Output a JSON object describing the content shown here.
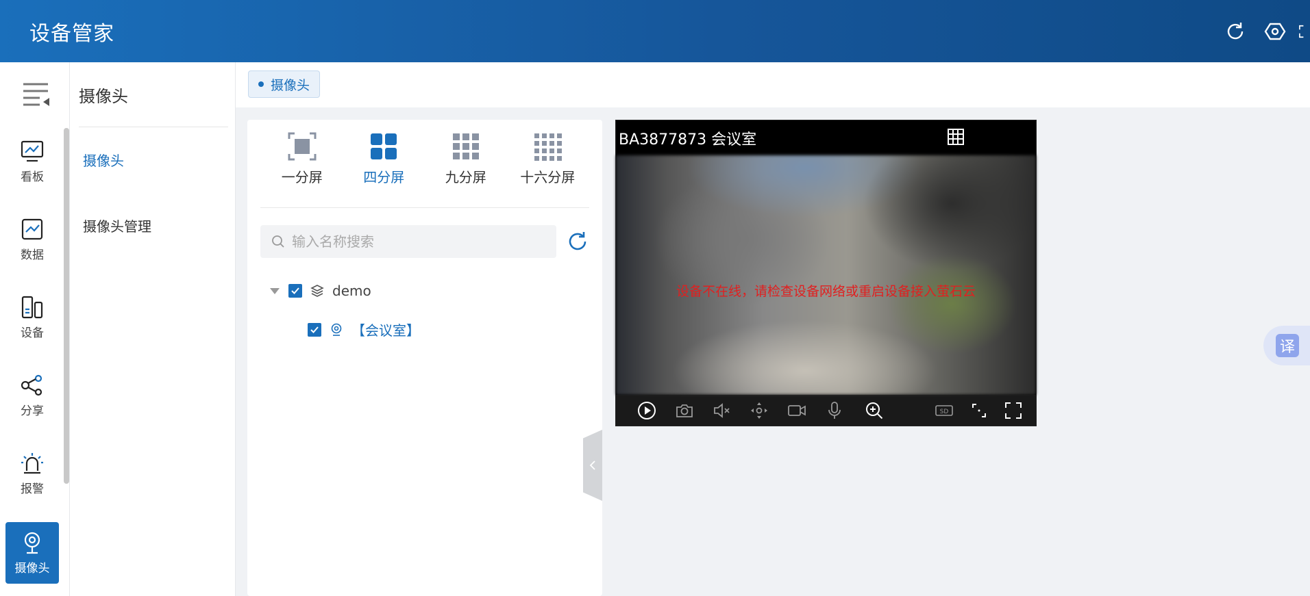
{
  "header": {
    "title": "设备管家"
  },
  "rail": {
    "items": [
      {
        "label": "看板"
      },
      {
        "label": "数据"
      },
      {
        "label": "设备"
      },
      {
        "label": "分享"
      },
      {
        "label": "报警"
      },
      {
        "label": "摄像头"
      }
    ]
  },
  "submenu": {
    "title": "摄像头",
    "items": [
      {
        "label": "摄像头"
      },
      {
        "label": "摄像头管理"
      }
    ]
  },
  "tabs": [
    {
      "label": "摄像头"
    }
  ],
  "layouts": [
    {
      "label": "一分屏"
    },
    {
      "label": "四分屏"
    },
    {
      "label": "九分屏"
    },
    {
      "label": "十六分屏"
    }
  ],
  "search": {
    "placeholder": "输入名称搜索"
  },
  "tree": {
    "root": {
      "label": "demo"
    },
    "child": {
      "label": "【会议室】"
    }
  },
  "video": {
    "title": "BA3877873 会议室",
    "message": "设备不在线，请检查设备网络或重启设备接入萤石云",
    "quality": "SD"
  },
  "translate": {
    "label": "译"
  },
  "colors": {
    "accent": "#1a6fbb",
    "header": "#16569a",
    "error": "#e02020"
  }
}
